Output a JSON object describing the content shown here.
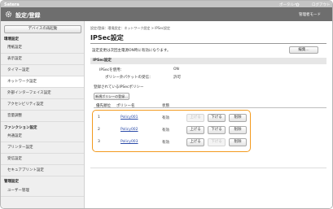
{
  "topbar": {
    "brand": "Satera",
    "portal_link": "ポータルへ",
    "logout_link": "ログアウト"
  },
  "header": {
    "title": "設定/登録",
    "admin_mode": "管理者モード",
    "icon": "gear-icon"
  },
  "sidebar": {
    "device_button": "デバイスの再起動",
    "groups": [
      {
        "label": "環境設定"
      },
      {
        "label": "ファンクション設定"
      },
      {
        "label": "管理設定"
      }
    ],
    "items": [
      {
        "label": "用紙設定"
      },
      {
        "label": "表示設定"
      },
      {
        "label": "タイマー設定"
      },
      {
        "label": "ネットワーク設定"
      },
      {
        "label": "外部インターフェイス設定"
      },
      {
        "label": "アクセシビリティ設定"
      },
      {
        "label": "音量調整"
      },
      {
        "label": "共通設定"
      },
      {
        "label": "プリンター設定"
      },
      {
        "label": "受信設定"
      },
      {
        "label": "セキュアプリント設定"
      },
      {
        "label": "ユーザー管理"
      }
    ]
  },
  "main": {
    "breadcrumb": "設定/登録：環境設定：ネットワーク設定 > IPSec設定",
    "title": "IPSec設定",
    "notice": "設定変更は次回主電源ON時に有効になります。",
    "edit_button": "編集...",
    "section": "IPSec設定",
    "settings": [
      {
        "label": "IPSecを使用：",
        "value": "ON"
      },
      {
        "label": "ポリシー外パケットの受信：",
        "value": "許可"
      }
    ],
    "registered_header": "登録されているIPSecポリシー",
    "register_button": "新規ポリシーの登録...",
    "table": {
      "headers": [
        "優先順位",
        "ポリシー名",
        "状態"
      ],
      "rows": [
        {
          "priority": "1",
          "name": "Policy001",
          "status": "有効",
          "up": "上げる",
          "down": "下げる",
          "delete": "削除",
          "up_enabled": false,
          "down_enabled": true
        },
        {
          "priority": "2",
          "name": "Policy002",
          "status": "有効",
          "up": "上げる",
          "down": "下げる",
          "delete": "削除",
          "up_enabled": true,
          "down_enabled": true
        },
        {
          "priority": "3",
          "name": "Policy003",
          "status": "有効",
          "up": "上げる",
          "down": "下げる",
          "delete": "削除",
          "up_enabled": true,
          "down_enabled": false
        }
      ]
    },
    "highlight_color": "#f39a1e"
  }
}
